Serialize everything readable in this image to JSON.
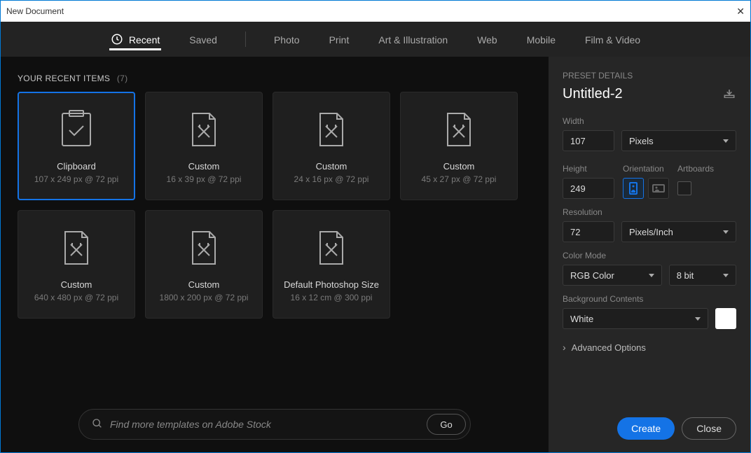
{
  "window": {
    "title": "New Document"
  },
  "tabs": [
    "Recent",
    "Saved",
    "Photo",
    "Print",
    "Art & Illustration",
    "Web",
    "Mobile",
    "Film & Video"
  ],
  "active_tab": "Recent",
  "recent": {
    "header": "YOUR RECENT ITEMS",
    "count": "(7)",
    "items": [
      {
        "label": "Clipboard",
        "meta": "107 x 249 px @ 72 ppi",
        "icon": "clipboard",
        "selected": true
      },
      {
        "label": "Custom",
        "meta": "16 x 39 px @ 72 ppi",
        "icon": "doc",
        "selected": false
      },
      {
        "label": "Custom",
        "meta": "24 x 16 px @ 72 ppi",
        "icon": "doc",
        "selected": false
      },
      {
        "label": "Custom",
        "meta": "45 x 27 px @ 72 ppi",
        "icon": "doc",
        "selected": false
      },
      {
        "label": "Custom",
        "meta": "640 x 480 px @ 72 ppi",
        "icon": "doc",
        "selected": false
      },
      {
        "label": "Custom",
        "meta": "1800 x 200 px @ 72 ppi",
        "icon": "doc",
        "selected": false
      },
      {
        "label": "Default Photoshop Size",
        "meta": "16 x 12 cm @ 300 ppi",
        "icon": "doc",
        "selected": false
      }
    ]
  },
  "search": {
    "placeholder": "Find more templates on Adobe Stock",
    "go": "Go"
  },
  "preset": {
    "header": "PRESET DETAILS",
    "name": "Untitled-2",
    "width_label": "Width",
    "width_value": "107",
    "width_unit": "Pixels",
    "height_label": "Height",
    "height_value": "249",
    "orientation_label": "Orientation",
    "artboards_label": "Artboards",
    "resolution_label": "Resolution",
    "resolution_value": "72",
    "resolution_unit": "Pixels/Inch",
    "colormode_label": "Color Mode",
    "colormode_value": "RGB Color",
    "colormode_bits": "8 bit",
    "bg_label": "Background Contents",
    "bg_value": "White",
    "bg_color": "#ffffff",
    "advanced": "Advanced Options"
  },
  "buttons": {
    "create": "Create",
    "close": "Close"
  }
}
